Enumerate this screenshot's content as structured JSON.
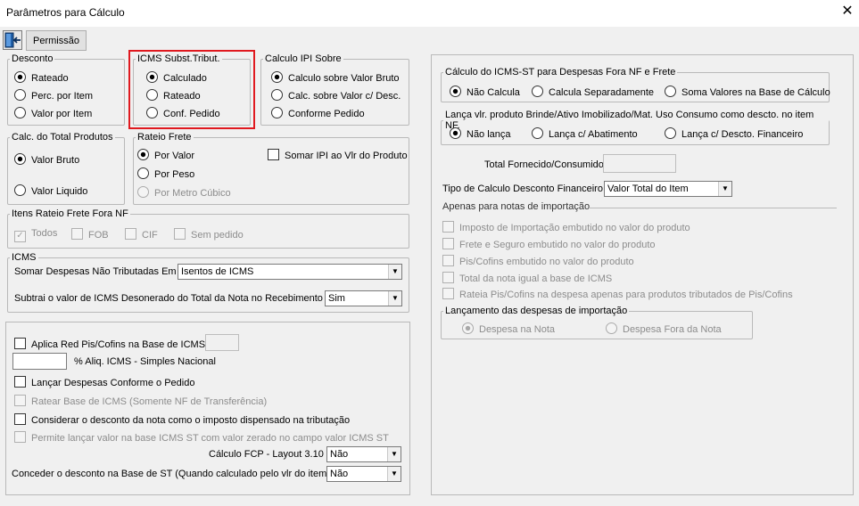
{
  "window": {
    "title": "Parâmetros para Cálculo",
    "close_glyph": "✕"
  },
  "toolbar": {
    "exit_icon": "exit-door-icon",
    "permissao_label": "Permissão"
  },
  "desconto": {
    "legend": "Desconto",
    "options": [
      "Rateado",
      "Perc. por Item",
      "Valor por Item"
    ],
    "selected": "Rateado"
  },
  "icms_st": {
    "legend": "ICMS Subst.Tribut.",
    "options": [
      "Calculado",
      "Rateado",
      "Conf. Pedido"
    ],
    "selected": "Calculado",
    "highlight_color": "#e0191f"
  },
  "calculo_ipi": {
    "legend": "Calculo IPI Sobre",
    "options": [
      "Calculo sobre Valor Bruto",
      "Calc. sobre Valor c/ Desc.",
      "Conforme Pedido"
    ],
    "selected": "Calculo sobre Valor Bruto"
  },
  "calc_total": {
    "legend": "Calc. do Total Produtos",
    "options": [
      "Valor Bruto",
      "Valor Liquido"
    ],
    "selected": "Valor Bruto"
  },
  "rateio_frete": {
    "legend": "Rateio Frete",
    "options": [
      "Por Valor",
      "Por Peso",
      "Por Metro Cúbico"
    ],
    "selected": "Por Valor",
    "somar_ipi": "Somar IPI ao Vlr do Produto"
  },
  "itens_rateio": {
    "legend": "Itens Rateio Frete Fora NF",
    "options": [
      "Todos",
      "FOB",
      "CIF",
      "Sem pedido"
    ],
    "checked": [
      "Todos"
    ]
  },
  "icms": {
    "legend": "ICMS",
    "somar_label": "Somar Despesas Não Tributadas Em",
    "somar_value": "Isentos de ICMS",
    "subtrai_label": "Subtrai o valor de ICMS Desonerado do Total da Nota no Recebimento",
    "subtrai_value": "Sim"
  },
  "outros": {
    "aplica_red": "Aplica Red Pis/Cofins na Base de ICMS",
    "aliq_label": "% Aliq. ICMS - Simples Nacional",
    "lancar_despesas": "Lançar Despesas Conforme o Pedido",
    "ratear_base": "Ratear Base de ICMS (Somente NF de Transferência)",
    "considerar_desconto": "Considerar o desconto da nota como o imposto dispensado na tributação",
    "permite_lancar": "Permite lançar valor na base ICMS ST com valor zerado no campo valor ICMS ST",
    "fcp_label": "Cálculo FCP - Layout 3.10",
    "fcp_value": "Não",
    "conceder_label": "Conceder o desconto na Base de ST (Quando calculado pelo vlr do item)",
    "conceder_value": "Não"
  },
  "right": {
    "calculo_st": {
      "legend": "Cálculo do ICMS-ST para Despesas Fora NF e Frete",
      "options": [
        "Não Calcula",
        "Calcula Separadamente",
        "Soma Valores na Base de Cálculo"
      ],
      "selected": "Não Calcula"
    },
    "lanca_brinde": {
      "legend": "Lança vlr. produto Brinde/Ativo Imobilizado/Mat. Uso Consumo como descto. no item NF.",
      "options": [
        "Não lança",
        "Lança c/ Abatimento",
        "Lança c/ Descto. Financeiro"
      ],
      "selected": "Não lança"
    },
    "total_fornecido_label": "Total Fornecido/Consumido",
    "tipo_calculo_label": "Tipo de Calculo Desconto Financeiro",
    "tipo_calculo_value": "Valor Total do Item",
    "importacao_header": "Apenas para notas de importação",
    "importacao_checks": [
      "Imposto de Importação embutido no valor do produto",
      "Frete e Seguro embutido no valor do produto",
      "Pis/Cofins embutido no valor do produto",
      "Total da nota igual a base de ICMS",
      "Rateia Pis/Cofins na despesa apenas para produtos tributados de Pis/Cofins"
    ],
    "lancamento": {
      "legend": "Lançamento das despesas de importação",
      "options": [
        "Despesa na Nota",
        "Despesa Fora da Nota"
      ],
      "selected": "Despesa na Nota"
    }
  }
}
